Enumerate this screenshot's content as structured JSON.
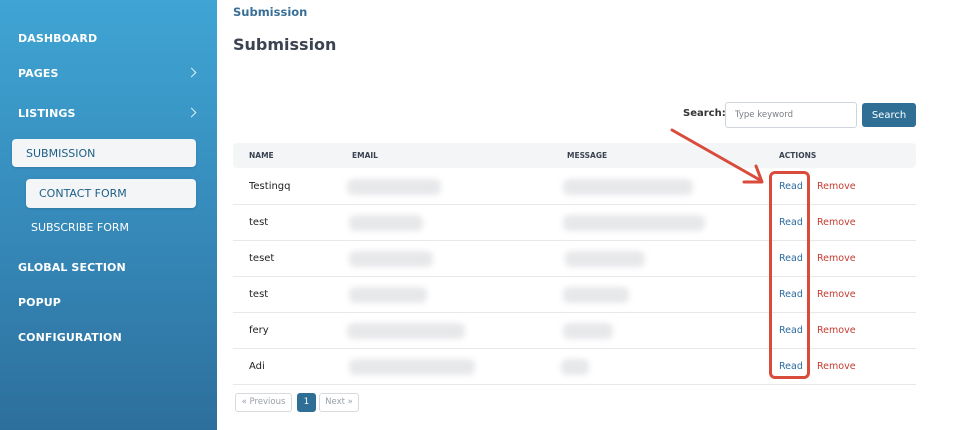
{
  "sidebar": {
    "items": [
      {
        "label": "DASHBOARD"
      },
      {
        "label": "PAGES"
      },
      {
        "label": "LISTINGS"
      },
      {
        "label": "SUBMISSION"
      },
      {
        "label": "CONTACT FORM"
      },
      {
        "label": "SUBSCRIBE FORM"
      },
      {
        "label": "GLOBAL SECTION"
      },
      {
        "label": "POPUP"
      },
      {
        "label": "CONFIGURATION"
      }
    ]
  },
  "header": {
    "breadcrumb": "Submission",
    "title": "Submission"
  },
  "search": {
    "label": "Search:",
    "placeholder": "Type keyword",
    "button_label": "Search"
  },
  "table": {
    "columns": [
      "NAME",
      "EMAIL",
      "MESSAGE",
      "ACTIONS"
    ],
    "rows": [
      {
        "name": "Testingq",
        "read": "Read",
        "remove": "Remove"
      },
      {
        "name": "test",
        "read": "Read",
        "remove": "Remove"
      },
      {
        "name": "teset",
        "read": "Read",
        "remove": "Remove"
      },
      {
        "name": "test",
        "read": "Read",
        "remove": "Remove"
      },
      {
        "name": "fery",
        "read": "Read",
        "remove": "Remove"
      },
      {
        "name": "Adi",
        "read": "Read",
        "remove": "Remove"
      }
    ]
  },
  "pagination": {
    "previous": "« Previous",
    "current": "1",
    "next": "Next »"
  },
  "colors": {
    "accent": "#2f6f96",
    "annotation": "#d94b3b",
    "remove": "#c43a2f",
    "read": "#2d6aa0"
  }
}
